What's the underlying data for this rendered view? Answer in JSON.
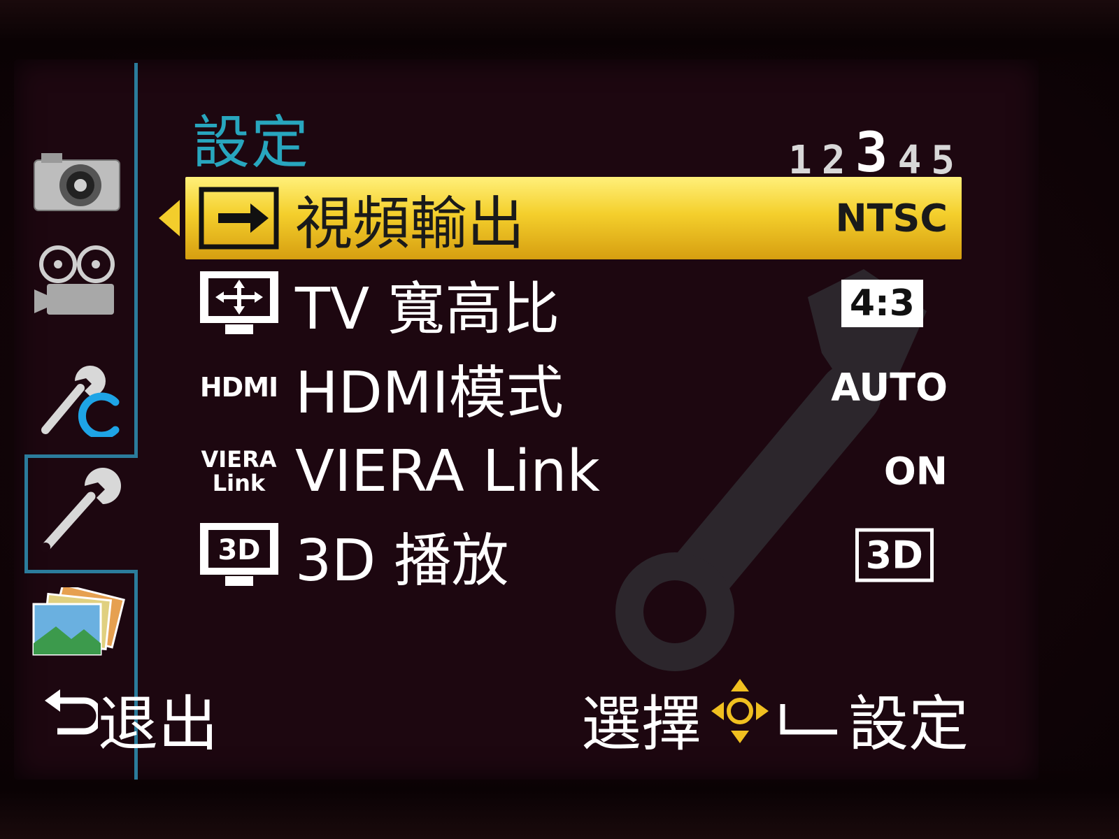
{
  "menu": {
    "title": "設定",
    "pages": [
      "1",
      "2",
      "3",
      "4",
      "5"
    ],
    "active_page": "3",
    "items": [
      {
        "label": "視頻輸出",
        "value": "NTSC",
        "icon": "video-output-icon",
        "selected": true
      },
      {
        "label": "TV 寬高比",
        "value": "4:3",
        "icon": "tv-aspect-icon",
        "selected": false
      },
      {
        "label": "HDMI模式",
        "value": "AUTO",
        "icon": "hdmi-icon",
        "icon_text": "HDMI",
        "selected": false
      },
      {
        "label": "VIERA Link",
        "value": "ON",
        "icon": "viera-link-icon",
        "icon_text": "VIERA Link",
        "selected": false
      },
      {
        "label": "3D 播放",
        "value": "3D",
        "icon": "3d-playback-icon",
        "icon_text": "3D",
        "selected": false
      }
    ]
  },
  "tabs": [
    {
      "icon": "camera-icon"
    },
    {
      "icon": "movie-camera-icon"
    },
    {
      "icon": "custom-wrench-icon",
      "badge": "C"
    },
    {
      "icon": "setup-wrench-icon",
      "active": true
    },
    {
      "icon": "playback-photos-icon"
    }
  ],
  "footer": {
    "exit_label": "退出",
    "select_label": "選擇",
    "set_label": "設定"
  },
  "colors": {
    "accent": "#28a6be",
    "highlight_top": "#fff07a",
    "highlight_bottom": "#d69e10",
    "background": "#1d0710"
  }
}
